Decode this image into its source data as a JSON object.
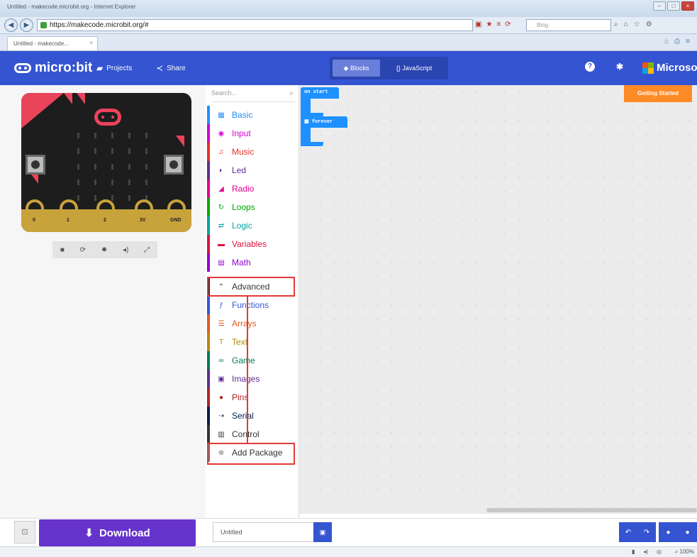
{
  "window": {
    "title": "Untitled - makecode.microbit.org - Internet Explorer"
  },
  "browser": {
    "url": "https://makecode.microbit.org/#",
    "tab_label": "Untitled - makecode...",
    "search_placeholder": "Bing",
    "zoom": "100%"
  },
  "header": {
    "logo": "micro:bit",
    "projects": "Projects",
    "share": "Share",
    "blocks": "Blocks",
    "javascript": "{} JavaScript",
    "brand": "Microsoft"
  },
  "simulator": {
    "pins": [
      "0",
      "1",
      "2",
      "3V",
      "GND"
    ]
  },
  "toolbox": {
    "search_placeholder": "Search...",
    "categories": [
      {
        "label": "Basic",
        "color": "#1e90ff",
        "icon": "grid-icon"
      },
      {
        "label": "Input",
        "color": "#d400d4",
        "icon": "target-icon"
      },
      {
        "label": "Music",
        "color": "#e63022",
        "icon": "headphones-icon"
      },
      {
        "label": "Led",
        "color": "#5c2d91",
        "icon": "toggle-icon"
      },
      {
        "label": "Radio",
        "color": "#e3008c",
        "icon": "signal-icon"
      },
      {
        "label": "Loops",
        "color": "#00aa00",
        "icon": "refresh-icon"
      },
      {
        "label": "Logic",
        "color": "#00a4a6",
        "icon": "shuffle-icon"
      },
      {
        "label": "Variables",
        "color": "#dc143c",
        "icon": "lines-icon"
      },
      {
        "label": "Math",
        "color": "#9400d3",
        "icon": "calculator-icon"
      },
      {
        "label": "Advanced",
        "color": "#333333",
        "icon": "chevron-up-icon"
      },
      {
        "label": "Functions",
        "color": "#3455db",
        "icon": "function-icon"
      },
      {
        "label": "Arrays",
        "color": "#e65722",
        "icon": "list-icon"
      },
      {
        "label": "Text",
        "color": "#b8860b",
        "icon": "text-icon"
      },
      {
        "label": "Game",
        "color": "#007a4b",
        "icon": "game-icon"
      },
      {
        "label": "Images",
        "color": "#5c2d91",
        "icon": "image-icon"
      },
      {
        "label": "Pins",
        "color": "#b22222",
        "icon": "pin-icon"
      },
      {
        "label": "Serial",
        "color": "#002050",
        "icon": "usb-icon"
      },
      {
        "label": "Control",
        "color": "#333333",
        "icon": "control-icon"
      },
      {
        "label": "Add Package",
        "color": "#717171",
        "icon": "plus-circle-icon"
      }
    ]
  },
  "workspace": {
    "on_start": "on start",
    "forever": "forever",
    "getting_started": "Getting Started"
  },
  "bottom": {
    "download": "Download",
    "project_name": "Untitled"
  }
}
